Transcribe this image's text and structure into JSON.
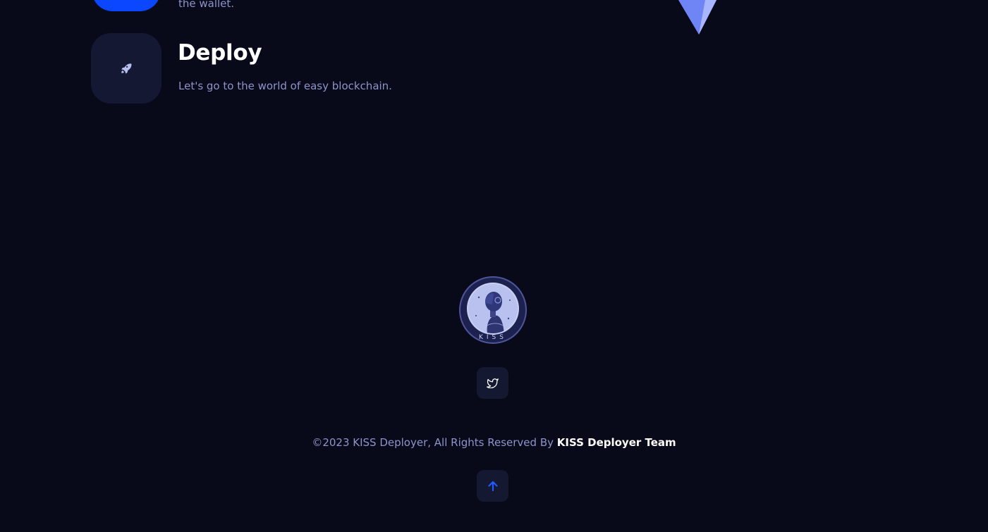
{
  "steps": {
    "previous": {
      "description_tail": "the wallet.",
      "icon": "wallet-icon",
      "accent": "#0a47ff"
    },
    "deploy": {
      "title": "Deploy",
      "description": "Let's go to the world of easy blockchain.",
      "icon": "rocket-icon"
    }
  },
  "footer": {
    "logo_text": "KISS",
    "social": [
      {
        "name": "twitter",
        "icon": "twitter-icon"
      }
    ],
    "copyright_prefix": "©2023 KISS Deployer, All Rights Reserved By ",
    "copyright_owner": "KISS Deployer Team",
    "back_to_top_icon": "arrow-up-icon"
  },
  "colors": {
    "background": "#080a1a",
    "card": "#141832",
    "muted_text": "#8e93c9",
    "accent": "#0a47ff"
  }
}
